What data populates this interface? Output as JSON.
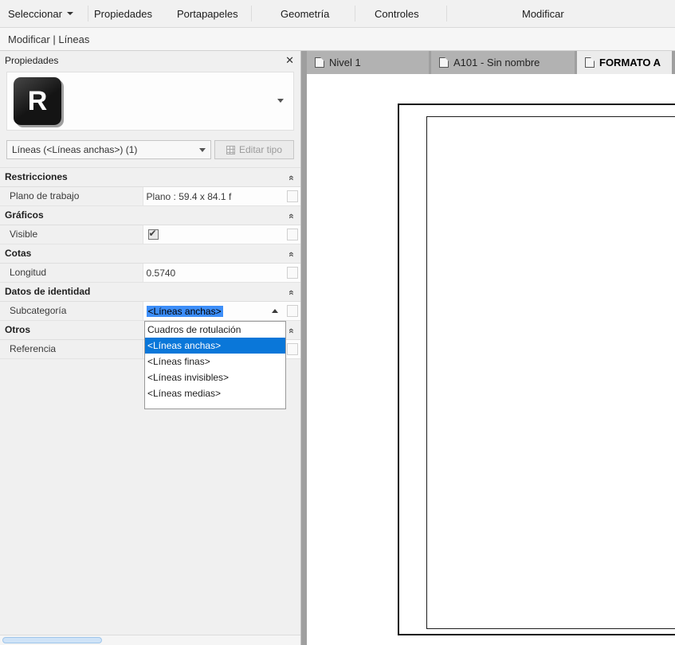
{
  "ribbon": {
    "items": [
      {
        "label": "Seleccionar"
      },
      {
        "label": "Propiedades"
      },
      {
        "label": "Portapapeles"
      },
      {
        "label": "Geometría"
      },
      {
        "label": "Controles"
      },
      {
        "label": "Modificar"
      }
    ]
  },
  "mode_bar": {
    "label": "Modificar | Líneas"
  },
  "icons": {
    "close": "✕",
    "collapse": "«",
    "logo_letter": "R"
  },
  "properties": {
    "title": "Propiedades",
    "type_selector_value": "Líneas (<Líneas anchas>) (1)",
    "edit_type_label": "Editar tipo",
    "sections": {
      "restricciones": "Restricciones",
      "graficos": "Gráficos",
      "cotas": "Cotas",
      "identidad": "Datos de identidad",
      "otros": "Otros"
    },
    "rows": {
      "plano_label": "Plano de trabajo",
      "plano_value": "Plano : 59.4 x 84.1 f",
      "visible_label": "Visible",
      "visible_checked": true,
      "longitud_label": "Longitud",
      "longitud_value": "0.5740",
      "subcategoria_label": "Subcategoría",
      "subcategoria_value": "<Líneas anchas>",
      "referencia_label": "Referencia"
    },
    "dropdown": {
      "items": [
        "Cuadros de rotulación",
        "<Líneas anchas>",
        "<Líneas finas>",
        "<Líneas invisibles>",
        "<Líneas medias>"
      ],
      "selected_index": 1
    }
  },
  "view_tabs": {
    "tabs": [
      {
        "label": "Nivel 1"
      },
      {
        "label": "A101 - Sin nombre"
      },
      {
        "label": "FORMATO A"
      }
    ],
    "active_index": 2
  },
  "colors": {
    "selection_blue": "#0a77d9",
    "field_highlight": "#3d8ef8"
  }
}
